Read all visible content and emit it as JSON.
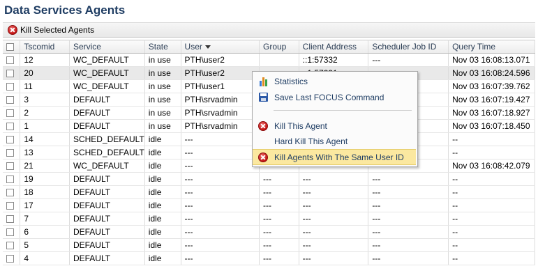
{
  "page": {
    "title": "Data Services Agents"
  },
  "toolbar": {
    "kill_selected_label": "Kill Selected Agents"
  },
  "columns": [
    "Tscomid",
    "Service",
    "State",
    "User",
    "Group",
    "Client Address",
    "Scheduler Job ID",
    "Query Time"
  ],
  "rows": [
    [
      "12",
      "WC_DEFAULT",
      "in use",
      "PTH\\user2",
      "",
      "::1:57332",
      "---",
      "Nov 03 16:08:13.071"
    ],
    [
      "20",
      "WC_DEFAULT",
      "in use",
      "PTH\\user2",
      "",
      "::1:57331",
      "",
      "Nov 03 16:08:24.596"
    ],
    [
      "11",
      "WC_DEFAULT",
      "in use",
      "PTH\\user1",
      "",
      "",
      "",
      "Nov 03 16:07:39.762"
    ],
    [
      "3",
      "DEFAULT",
      "in use",
      "PTH\\srvadmin",
      "",
      "",
      "",
      "Nov 03 16:07:19.427"
    ],
    [
      "2",
      "DEFAULT",
      "in use",
      "PTH\\srvadmin",
      "",
      "",
      "",
      "Nov 03 16:07:18.927"
    ],
    [
      "1",
      "DEFAULT",
      "in use",
      "PTH\\srvadmin",
      "",
      "",
      "",
      "Nov 03 16:07:18.450"
    ],
    [
      "14",
      "SCHED_DEFAULT",
      "idle",
      "---",
      "",
      "",
      "",
      "--"
    ],
    [
      "13",
      "SCHED_DEFAULT",
      "idle",
      "---",
      "",
      "",
      "",
      "--"
    ],
    [
      "21",
      "WC_DEFAULT",
      "idle",
      "---",
      "",
      "",
      "",
      "Nov 03 16:08:42.079"
    ],
    [
      "19",
      "DEFAULT",
      "idle",
      "---",
      "---",
      "---",
      "---",
      "--"
    ],
    [
      "18",
      "DEFAULT",
      "idle",
      "---",
      "---",
      "---",
      "---",
      "--"
    ],
    [
      "17",
      "DEFAULT",
      "idle",
      "---",
      "---",
      "---",
      "---",
      "--"
    ],
    [
      "7",
      "DEFAULT",
      "idle",
      "---",
      "---",
      "---",
      "---",
      "--"
    ],
    [
      "6",
      "DEFAULT",
      "idle",
      "---",
      "---",
      "---",
      "---",
      "--"
    ],
    [
      "5",
      "DEFAULT",
      "idle",
      "---",
      "---",
      "---",
      "---",
      "--"
    ],
    [
      "4",
      "DEFAULT",
      "idle",
      "---",
      "---",
      "---",
      "---",
      "--"
    ]
  ],
  "selected_row": 1,
  "sorted_column": 3,
  "context_menu": {
    "items": [
      {
        "label": "Statistics",
        "icon": "bar-chart-icon"
      },
      {
        "label": "Save Last FOCUS Command",
        "icon": "floppy-disk-icon"
      },
      {
        "label": "Kill This Agent",
        "icon": "red-x-icon"
      },
      {
        "label": "Hard Kill This Agent",
        "icon": ""
      },
      {
        "label": "Kill Agents With The Same User ID",
        "icon": "red-x-icon",
        "highlighted": true
      }
    ]
  },
  "colors": {
    "title": "#1f3d63",
    "menu_highlight": "#fbe8a0",
    "selected_row": "#e9e9e9"
  }
}
